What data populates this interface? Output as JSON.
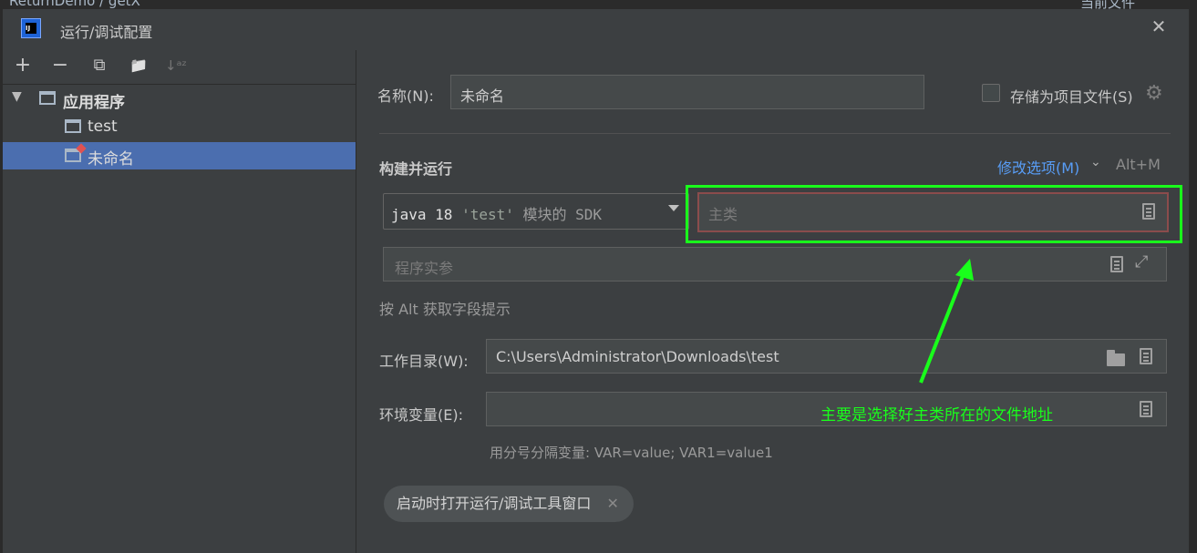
{
  "ide_background": {
    "breadcrumb": "ReturnDemo  /  getX",
    "right_label": "当前文件"
  },
  "dialog": {
    "title": "运行/调试配置",
    "close_glyph": "✕"
  },
  "toolbar": {
    "add": "+",
    "remove": "−",
    "copy": "⧉",
    "new_folder": "📁",
    "sort": "↓ᵃᶻ"
  },
  "tree": {
    "group_label": "应用程序",
    "items": [
      {
        "label": "test",
        "selected": false
      },
      {
        "label": "未命名",
        "selected": true
      }
    ]
  },
  "form": {
    "name_label": "名称(N):",
    "name_value": "未命名",
    "store_label": "存储为项目文件(S)",
    "store_checked": false,
    "section_title": "构建并运行",
    "modify_label": "修改选项(M)",
    "modify_shortcut": "Alt+M",
    "sdk_java": "java 18",
    "sdk_module": "'test'",
    "sdk_rest": "模块的 SDK",
    "main_class_placeholder": "主类",
    "args_placeholder": "程序实参",
    "hint": "按 Alt 获取字段提示",
    "workdir_label": "工作目录(W):",
    "workdir_value": "C:\\Users\\Administrator\\Downloads\\test",
    "env_label": "环境变量(E):",
    "env_value": "",
    "env_hint": "用分号分隔变量: VAR=value; VAR1=value1",
    "chip_label": "启动时打开运行/调试工具窗口",
    "chip_close": "✕"
  },
  "annotation": {
    "text": "主要是选择好主类所在的文件地址",
    "color": "#19ff1b"
  },
  "colors": {
    "background": "#3c3f41",
    "selection": "#4b6eaf",
    "link": "#589df6"
  }
}
